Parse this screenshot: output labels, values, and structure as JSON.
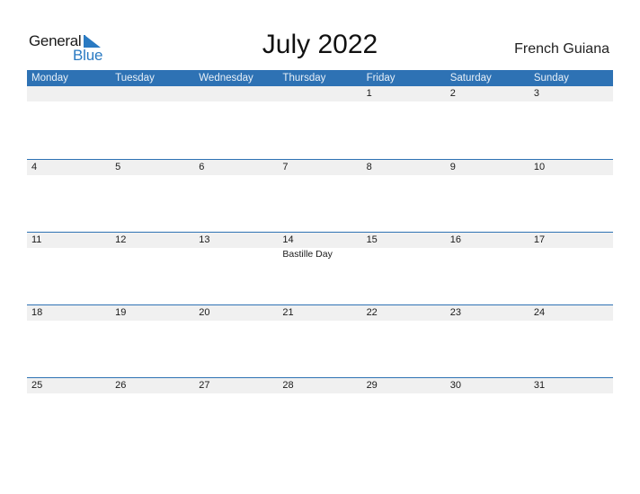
{
  "brand": {
    "line1": "General",
    "line2": "Blue",
    "color": "#2a7ac2"
  },
  "title": "July 2022",
  "region": "French Guiana",
  "header_color": "#2e72b4",
  "weekdays": [
    "Monday",
    "Tuesday",
    "Wednesday",
    "Thursday",
    "Friday",
    "Saturday",
    "Sunday"
  ],
  "weeks": [
    {
      "days": [
        "",
        "",
        "",
        "",
        "1",
        "2",
        "3"
      ],
      "events": [
        "",
        "",
        "",
        "",
        "",
        "",
        ""
      ]
    },
    {
      "days": [
        "4",
        "5",
        "6",
        "7",
        "8",
        "9",
        "10"
      ],
      "events": [
        "",
        "",
        "",
        "",
        "",
        "",
        ""
      ]
    },
    {
      "days": [
        "11",
        "12",
        "13",
        "14",
        "15",
        "16",
        "17"
      ],
      "events": [
        "",
        "",
        "",
        "Bastille Day",
        "",
        "",
        ""
      ]
    },
    {
      "days": [
        "18",
        "19",
        "20",
        "21",
        "22",
        "23",
        "24"
      ],
      "events": [
        "",
        "",
        "",
        "",
        "",
        "",
        ""
      ]
    },
    {
      "days": [
        "25",
        "26",
        "27",
        "28",
        "29",
        "30",
        "31"
      ],
      "events": [
        "",
        "",
        "",
        "",
        "",
        "",
        ""
      ]
    }
  ]
}
